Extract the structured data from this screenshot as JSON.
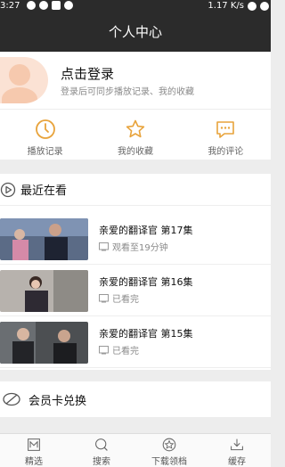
{
  "status": {
    "time": "3:27",
    "right": "1.17 K/s"
  },
  "header": {
    "title": "个人中心"
  },
  "login": {
    "title": "点击登录",
    "subtitle": "登录后可同步播放记录、我的收藏"
  },
  "quick": [
    {
      "label": "播放记录",
      "icon": "clock-icon"
    },
    {
      "label": "我的收藏",
      "icon": "star-icon"
    },
    {
      "label": "我的评论",
      "icon": "comment-icon"
    }
  ],
  "recent": {
    "title": "最近在看",
    "items": [
      {
        "episode": "亲爱的翻译官 第17集",
        "progress": "观看至19分钟"
      },
      {
        "episode": "亲爱的翻译官 第16集",
        "progress": "已看完"
      },
      {
        "episode": "亲爱的翻译官 第15集",
        "progress": "已看完"
      }
    ]
  },
  "member": {
    "label": "会员卡兑换"
  },
  "tabs": [
    {
      "label": "精选",
      "icon": "featured-icon"
    },
    {
      "label": "搜索",
      "icon": "search-icon"
    },
    {
      "label": "下载领档",
      "icon": "star-tab-icon"
    },
    {
      "label": "缓存",
      "icon": "download-icon"
    }
  ],
  "colors": {
    "accent": "#e8a33b",
    "bar": "#2b2b2b"
  }
}
